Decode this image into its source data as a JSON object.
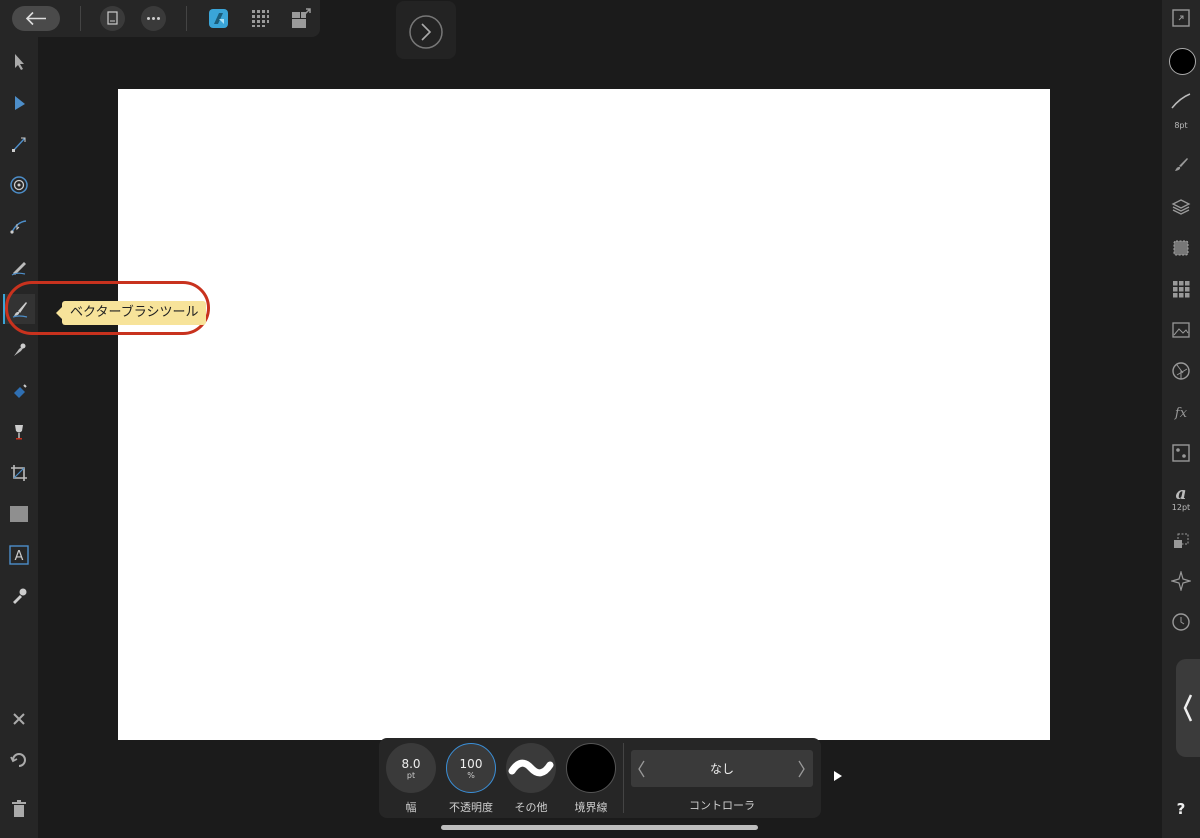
{
  "topbar": {
    "back_icon": "back-arrow-icon",
    "document_icon": "document-icon",
    "more_icon": "more-icon",
    "persona_designer_icon": "designer-persona-icon",
    "persona_pixel_icon": "pixel-persona-icon",
    "persona_export_icon": "export-persona-icon",
    "next_icon": "chevron-right-icon"
  },
  "tooltip": {
    "text": "ベクターブラシツール"
  },
  "context_toolbar": {
    "width": {
      "value": "8.0",
      "unit": "pt",
      "label": "幅"
    },
    "opacity": {
      "value": "100",
      "unit": "%",
      "label": "不透明度"
    },
    "other": {
      "label": "その他"
    },
    "stroke": {
      "label": "境界線"
    },
    "controller": {
      "value": "なし",
      "label": "コントローラ"
    }
  },
  "right_panel": {
    "brush_size_label": "8pt",
    "text_size_label": "12pt",
    "help_label": "?"
  },
  "colors": {
    "accent": "#3aa5d8",
    "highlight": "#c8321e",
    "tooltip_bg": "#f7e39a"
  }
}
